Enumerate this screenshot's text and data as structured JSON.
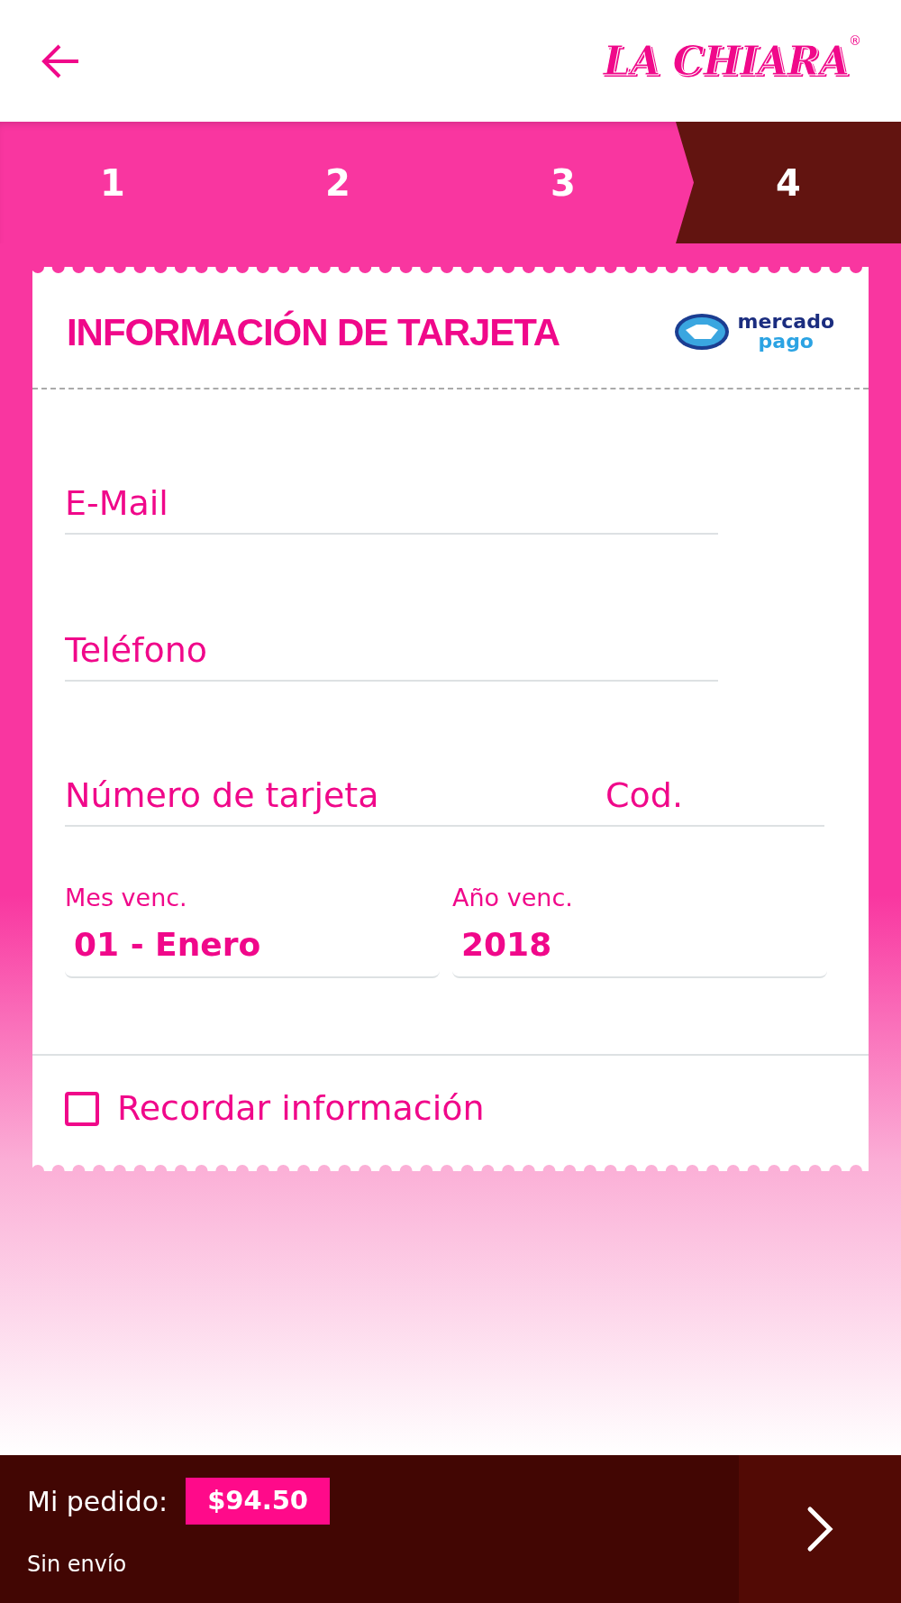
{
  "header": {
    "logo": "LA CHIARA",
    "logo_mark": "®"
  },
  "steps": [
    {
      "label": "1",
      "selected": false
    },
    {
      "label": "2",
      "selected": false
    },
    {
      "label": "3",
      "selected": false
    },
    {
      "label": "4",
      "selected": true
    }
  ],
  "card": {
    "title": "INFORMACIÓN DE **TARJETA**",
    "payment_logo": [
      "mercado",
      "pago"
    ],
    "fields": [
      {
        "placeholder": "E-Mail"
      },
      {
        "placeholder": "Teléfono"
      }
    ],
    "card_number": {
      "placeholder": "Número de tarjeta"
    },
    "code": {
      "placeholder": "Cod."
    },
    "selects": [
      {
        "label": "Mes venc.",
        "value": "01 - Enero"
      },
      {
        "label": "Año venc.",
        "value": "2018"
      }
    ],
    "remember": {
      "label": "Recordar información",
      "checked": false
    }
  },
  "footer": {
    "label": "Mi pedido:",
    "total": "$94.50",
    "shipping": "Sin envío"
  }
}
